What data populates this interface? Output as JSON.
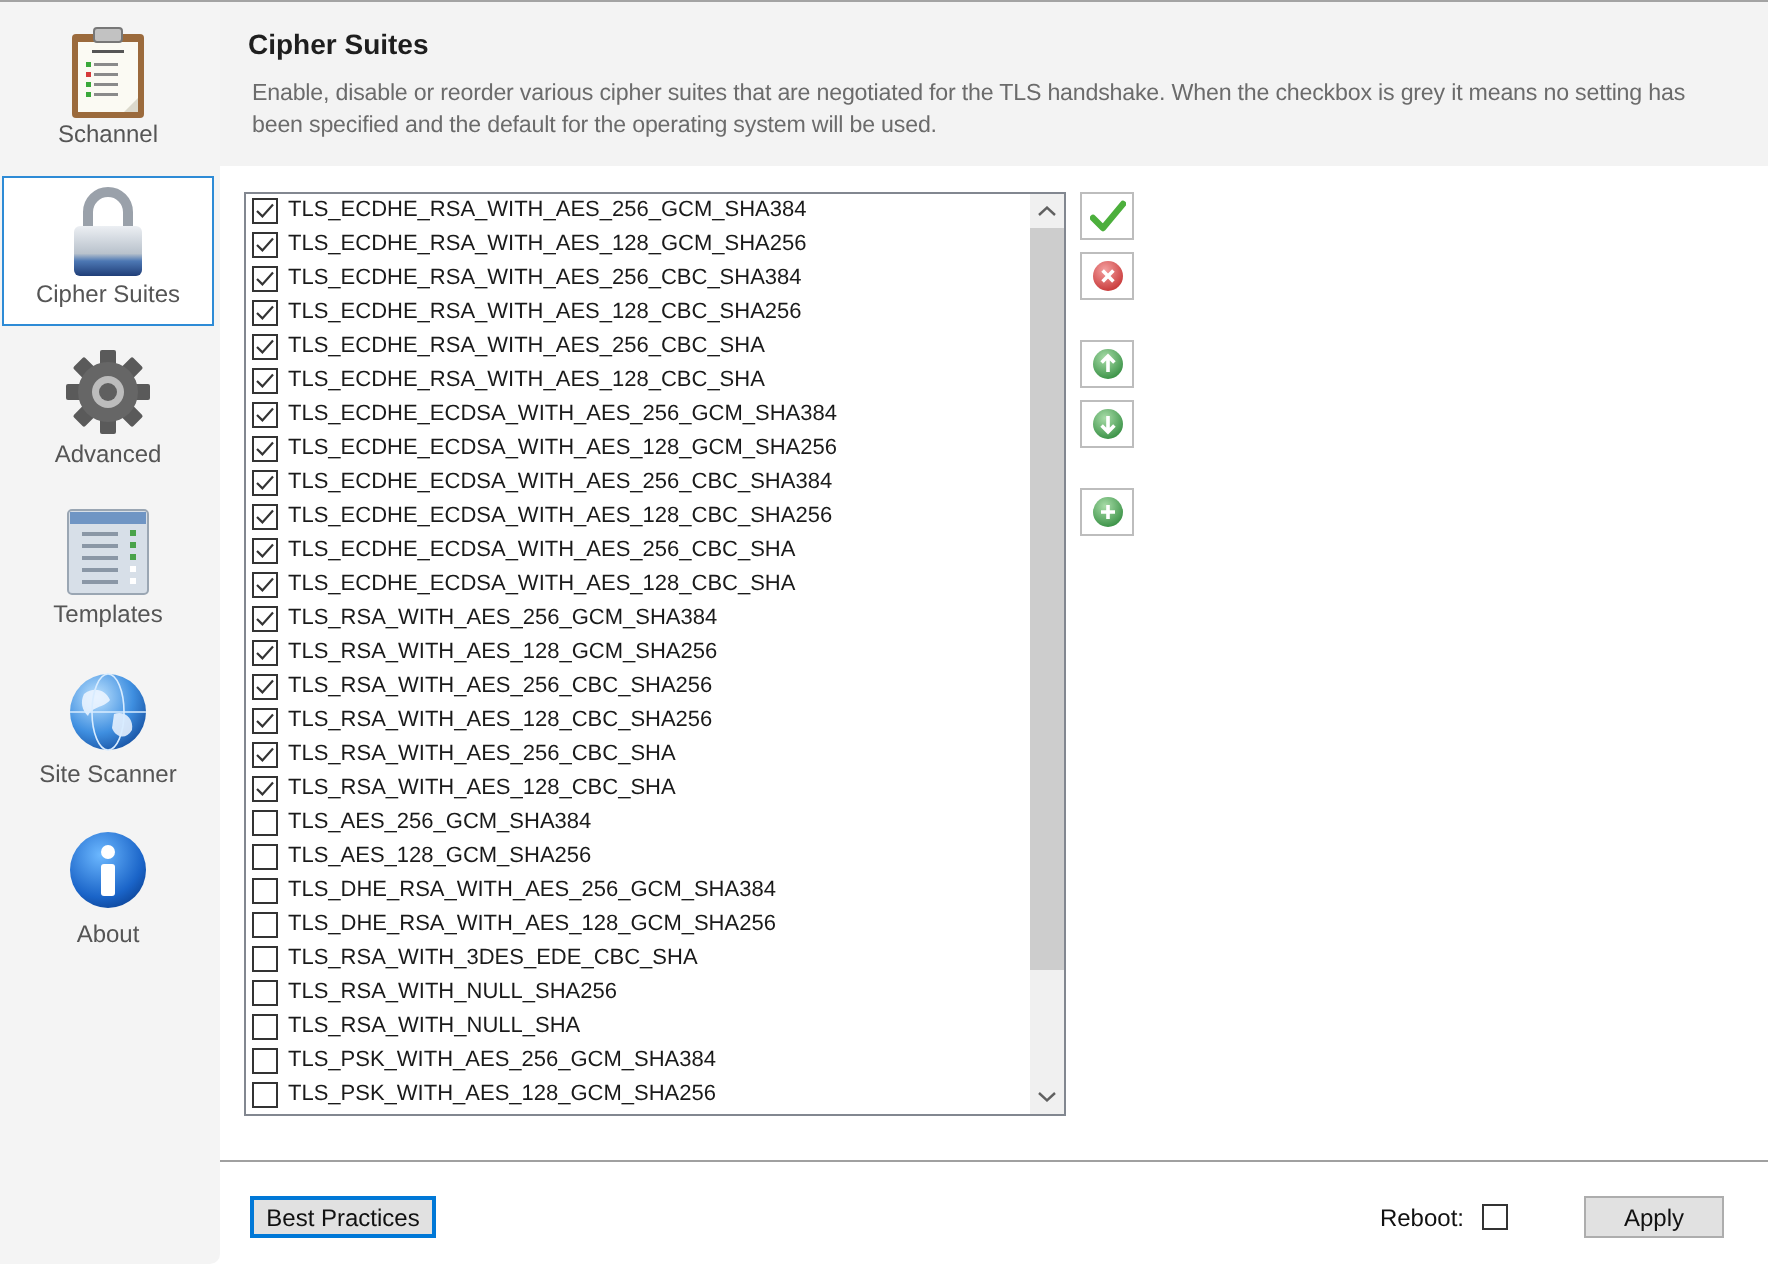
{
  "sidebar": {
    "items": [
      {
        "label": "Schannel",
        "selected": false
      },
      {
        "label": "Cipher Suites",
        "selected": true
      },
      {
        "label": "Advanced",
        "selected": false
      },
      {
        "label": "Templates",
        "selected": false
      },
      {
        "label": "Site Scanner",
        "selected": false
      },
      {
        "label": "About",
        "selected": false
      }
    ]
  },
  "header": {
    "title": "Cipher Suites",
    "description": "Enable, disable or reorder various cipher suites that are negotiated for the TLS handshake. When the checkbox is grey it means no setting has been specified and the default for the operating system will be used."
  },
  "cipher_suites": {
    "items": [
      {
        "name": "TLS_ECDHE_RSA_WITH_AES_256_GCM_SHA384",
        "checked": true
      },
      {
        "name": "TLS_ECDHE_RSA_WITH_AES_128_GCM_SHA256",
        "checked": true
      },
      {
        "name": "TLS_ECDHE_RSA_WITH_AES_256_CBC_SHA384",
        "checked": true
      },
      {
        "name": "TLS_ECDHE_RSA_WITH_AES_128_CBC_SHA256",
        "checked": true
      },
      {
        "name": "TLS_ECDHE_RSA_WITH_AES_256_CBC_SHA",
        "checked": true
      },
      {
        "name": "TLS_ECDHE_RSA_WITH_AES_128_CBC_SHA",
        "checked": true
      },
      {
        "name": "TLS_ECDHE_ECDSA_WITH_AES_256_GCM_SHA384",
        "checked": true
      },
      {
        "name": "TLS_ECDHE_ECDSA_WITH_AES_128_GCM_SHA256",
        "checked": true
      },
      {
        "name": "TLS_ECDHE_ECDSA_WITH_AES_256_CBC_SHA384",
        "checked": true
      },
      {
        "name": "TLS_ECDHE_ECDSA_WITH_AES_128_CBC_SHA256",
        "checked": true
      },
      {
        "name": "TLS_ECDHE_ECDSA_WITH_AES_256_CBC_SHA",
        "checked": true
      },
      {
        "name": "TLS_ECDHE_ECDSA_WITH_AES_128_CBC_SHA",
        "checked": true
      },
      {
        "name": "TLS_RSA_WITH_AES_256_GCM_SHA384",
        "checked": true
      },
      {
        "name": "TLS_RSA_WITH_AES_128_GCM_SHA256",
        "checked": true
      },
      {
        "name": "TLS_RSA_WITH_AES_256_CBC_SHA256",
        "checked": true
      },
      {
        "name": "TLS_RSA_WITH_AES_128_CBC_SHA256",
        "checked": true
      },
      {
        "name": "TLS_RSA_WITH_AES_256_CBC_SHA",
        "checked": true
      },
      {
        "name": "TLS_RSA_WITH_AES_128_CBC_SHA",
        "checked": true
      },
      {
        "name": "TLS_AES_256_GCM_SHA384",
        "checked": false
      },
      {
        "name": "TLS_AES_128_GCM_SHA256",
        "checked": false
      },
      {
        "name": "TLS_DHE_RSA_WITH_AES_256_GCM_SHA384",
        "checked": false
      },
      {
        "name": "TLS_DHE_RSA_WITH_AES_128_GCM_SHA256",
        "checked": false
      },
      {
        "name": "TLS_RSA_WITH_3DES_EDE_CBC_SHA",
        "checked": false
      },
      {
        "name": "TLS_RSA_WITH_NULL_SHA256",
        "checked": false
      },
      {
        "name": "TLS_RSA_WITH_NULL_SHA",
        "checked": false
      },
      {
        "name": "TLS_PSK_WITH_AES_256_GCM_SHA384",
        "checked": false
      },
      {
        "name": "TLS_PSK_WITH_AES_128_GCM_SHA256",
        "checked": false
      }
    ]
  },
  "footer": {
    "best_practices": {
      "label": "Best Practices",
      "focused": true
    },
    "reboot": {
      "label": "Reboot:",
      "checked": false
    },
    "apply": {
      "label": "Apply",
      "focused": false
    }
  }
}
